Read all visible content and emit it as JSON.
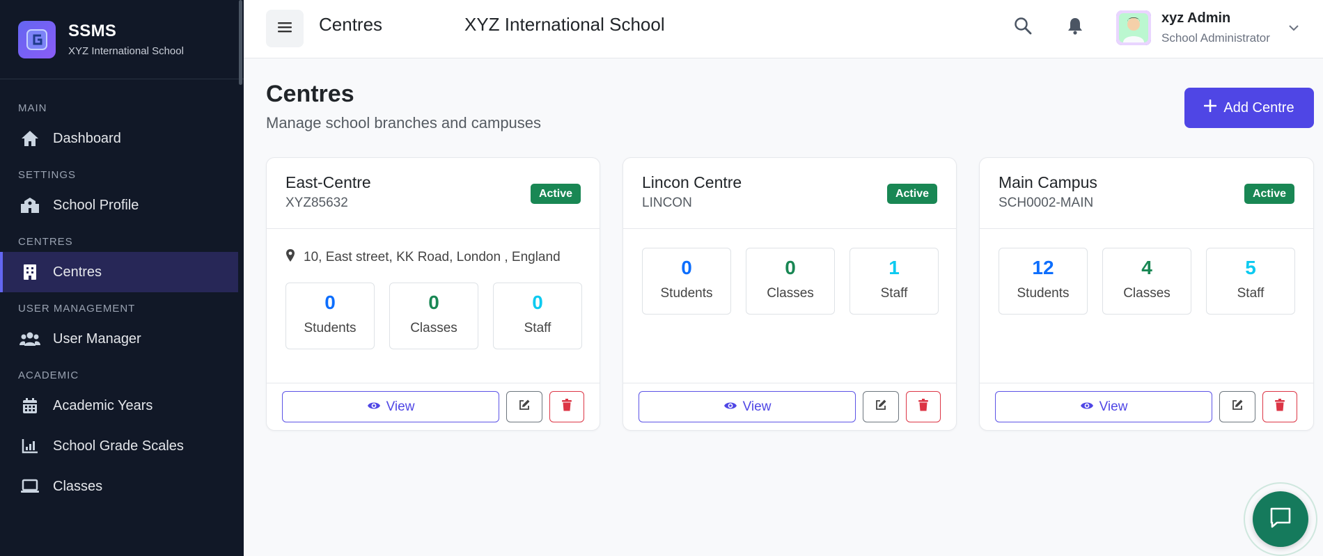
{
  "brand": {
    "title": "SSMS",
    "subtitle": "XYZ International School"
  },
  "sidebar": {
    "sections": [
      {
        "label": "MAIN",
        "items": [
          {
            "label": "Dashboard",
            "icon": "home-icon"
          }
        ]
      },
      {
        "label": "SETTINGS",
        "items": [
          {
            "label": "School Profile",
            "icon": "school-icon"
          }
        ]
      },
      {
        "label": "CENTRES",
        "items": [
          {
            "label": "Centres",
            "icon": "building-icon",
            "active": true
          }
        ]
      },
      {
        "label": "USER MANAGEMENT",
        "items": [
          {
            "label": "User Manager",
            "icon": "users-icon"
          }
        ]
      },
      {
        "label": "ACADEMIC",
        "items": [
          {
            "label": "Academic Years",
            "icon": "calendar-icon"
          },
          {
            "label": "School Grade Scales",
            "icon": "chart-icon"
          },
          {
            "label": "Classes",
            "icon": "laptop-icon"
          }
        ]
      }
    ]
  },
  "topbar": {
    "title": "Centres",
    "school": "XYZ International School",
    "user_name": "xyz Admin",
    "user_role": "School Administrator"
  },
  "page": {
    "title": "Centres",
    "subtitle": "Manage school branches and campuses",
    "add_label": "Add Centre"
  },
  "cards": [
    {
      "name": "East-Centre",
      "code": "XYZ85632",
      "status": "Active",
      "address": "10, East street, KK Road, London , England",
      "stats": {
        "students": "0",
        "classes": "0",
        "staff": "0"
      }
    },
    {
      "name": "Lincon Centre",
      "code": "LINCON",
      "status": "Active",
      "address": "",
      "stats": {
        "students": "0",
        "classes": "0",
        "staff": "1"
      }
    },
    {
      "name": "Main Campus",
      "code": "SCH0002-MAIN",
      "status": "Active",
      "address": "",
      "stats": {
        "students": "12",
        "classes": "4",
        "staff": "5"
      }
    }
  ],
  "labels": {
    "students": "Students",
    "classes": "Classes",
    "staff": "Staff",
    "view": "View"
  },
  "colors": {
    "accent": "#4f46e5",
    "sidebar": "#111827",
    "active_badge": "#198754",
    "danger": "#dc3545"
  }
}
